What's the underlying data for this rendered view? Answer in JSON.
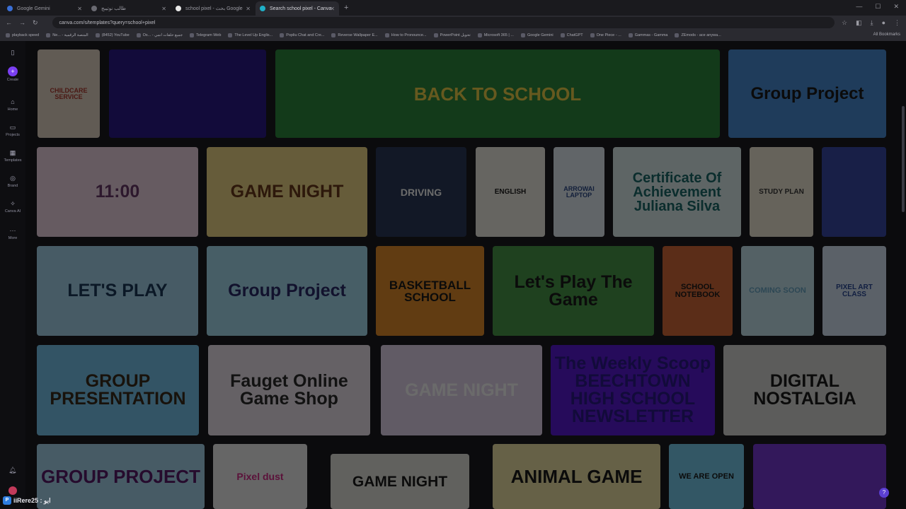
{
  "browser": {
    "tabs": [
      {
        "label": "Google Gemini"
      },
      {
        "label": "طالب نوتيبج"
      },
      {
        "label": "school pixel - بحث Google"
      },
      {
        "label": "Search school pixel - Canva"
      }
    ],
    "new_tab": "+",
    "url": "canva.com/s/templates?query=school+pixel",
    "bookmarks": [
      "playback speed",
      "Ne... - المنصة الرقمية",
      "(8452) YouTube",
      "Os... - جميع حلقات انمي",
      "Telegram Web",
      "The Level Up Englis...",
      "Popliu Chat and Cre...",
      "Reverse Wallpaper E...",
      "How to Pronounce...",
      "PowerPoint تحويل",
      "Microsoft 365 | ...",
      "Google Gemini",
      "ChatGPT",
      "One Piece - ...",
      "Gammas - Gamma",
      "ZEmods - ace anywa..."
    ],
    "all_bookmarks": "All Bookmarks"
  },
  "sidebar": {
    "items": [
      {
        "label": "Create",
        "icon": "plus-icon"
      },
      {
        "label": "Home",
        "icon": "home-icon"
      },
      {
        "label": "Projects",
        "icon": "folder-icon"
      },
      {
        "label": "Templates",
        "icon": "templates-icon"
      },
      {
        "label": "Brand",
        "icon": "brand-icon"
      },
      {
        "label": "Canva AI",
        "icon": "ai-icon"
      },
      {
        "label": "More",
        "icon": "more-icon"
      }
    ]
  },
  "cards": [
    {
      "text": "CHILDCARE SERVICE",
      "bg": "#e8d8c8",
      "fg": "#b0392e"
    },
    {
      "text": "",
      "bg": "#2a1a8a",
      "fg": "#ffffff"
    },
    {
      "text": "BACK TO SCHOOL",
      "bg": "#2e8b3e",
      "fg": "#f4d34a"
    },
    {
      "text": "Group Project",
      "bg": "#4a8fd8",
      "fg": "#1a1a1a"
    },
    {
      "text": "11:00",
      "bg": "#f2d8e6",
      "fg": "#6a3a6a"
    },
    {
      "text": "GAME NIGHT",
      "bg": "#f4dc8a",
      "fg": "#6a3a1a"
    },
    {
      "text": "DRIVING",
      "bg": "#2a3a5a",
      "fg": "#ffffff"
    },
    {
      "text": "ENGLISH",
      "bg": "#f4f0e8",
      "fg": "#1a1a1a"
    },
    {
      "text": "ARROWAI LAPTOP",
      "bg": "#e8f0f8",
      "fg": "#2a4a8a"
    },
    {
      "text": "Certificate Of Achievement Juliana Silva",
      "bg": "#dff0f0",
      "fg": "#1a6a6a"
    },
    {
      "text": "STUDY PLAN",
      "bg": "#f4ecd8",
      "fg": "#3a3a3a"
    },
    {
      "text": "",
      "bg": "#3a4aa8",
      "fg": "#ffffff"
    },
    {
      "text": "LET'S PLAY",
      "bg": "#a8d8f0",
      "fg": "#1a3a5a"
    },
    {
      "text": "Group Project",
      "bg": "#a8e0f4",
      "fg": "#2a2a6a"
    },
    {
      "text": "BASKETBALL SCHOOL",
      "bg": "#e8902a",
      "fg": "#1a1a1a"
    },
    {
      "text": "Let's Play The Game",
      "bg": "#4a9a4a",
      "fg": "#1a1a1a"
    },
    {
      "text": "SCHOOL NOTEBOOK",
      "bg": "#d86a3a",
      "fg": "#1a1a1a"
    },
    {
      "text": "COMING SOON",
      "bg": "#c8e8f0",
      "fg": "#6aa8c8"
    },
    {
      "text": "PIXEL ART CLASS",
      "bg": "#d8e8f8",
      "fg": "#2a4a9a"
    },
    {
      "text": "GROUP PRESENTATION",
      "bg": "#7ac8f0",
      "fg": "#3a2a1a"
    },
    {
      "text": "Fauget Online Game Shop",
      "bg": "#f0e8f0",
      "fg": "#2a2a2a"
    },
    {
      "text": "GAME NIGHT",
      "bg": "#e8d8f0",
      "fg": "#ffffff"
    },
    {
      "text": "The Weekly Scoop BEECHTOWN HIGH SCHOOL NEWSLETTER",
      "bg": "#5a1ad8",
      "fg": "#2a1a8a"
    },
    {
      "text": "DIGITAL NOSTALGIA",
      "bg": "#dcdcd8",
      "fg": "#1a1a1a"
    },
    {
      "text": "GROUP PROJECT",
      "bg": "#a8d8f0",
      "fg": "#5a1a6a"
    },
    {
      "text": "Pixel dust",
      "bg": "#f4f4f4",
      "fg": "#d82a8a"
    },
    {
      "text": "GAME NIGHT",
      "bg": "#e8e8e0",
      "fg": "#1a1a1a"
    },
    {
      "text": "ANIMAL GAME",
      "bg": "#f4e8a8",
      "fg": "#1a1a1a"
    },
    {
      "text": "WE ARE OPEN",
      "bg": "#7ad0f0",
      "fg": "#1a1a1a"
    },
    {
      "text": "",
      "bg": "#7a3ad8",
      "fg": "#ffffff"
    }
  ],
  "user": {
    "name": "iiRere25 : ابو"
  },
  "help": "?"
}
